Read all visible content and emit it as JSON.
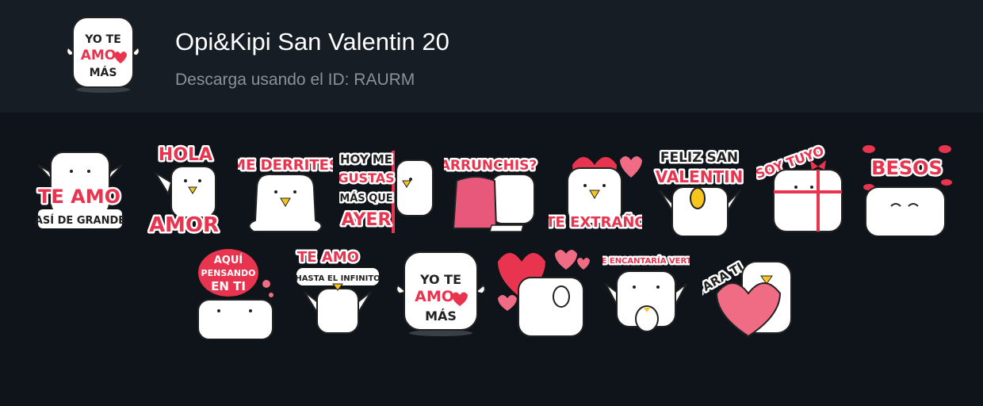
{
  "pack": {
    "title": "Opi&Kipi San Valentin 20",
    "subtitle": "Descarga usando el ID: RAURM",
    "icon": {
      "line1": "YO TE",
      "line2": "AMO",
      "line3": "MÁS"
    }
  },
  "colors": {
    "background": "#0f141b",
    "header": "#161d25",
    "accent_red": "#e8344e",
    "pink": "#f06b84",
    "beak": "#f7c51e"
  },
  "stickers_row1": [
    {
      "name": "te-amo-asi-de-grande",
      "lines": [
        "TE AMO",
        "ASÍ DE GRANDE"
      ]
    },
    {
      "name": "hola-amor",
      "lines": [
        "HOLA",
        "AMOR"
      ]
    },
    {
      "name": "me-derrites",
      "lines": [
        "ME DERRITES"
      ]
    },
    {
      "name": "hoy-me-gustas",
      "lines": [
        "HOY ME",
        "GUSTAS",
        "MÁS QUE",
        "AYER"
      ]
    },
    {
      "name": "arrunchis",
      "lines": [
        "ARRUNCHIS?"
      ]
    },
    {
      "name": "te-extrano",
      "lines": [
        "TE EXTRAÑO"
      ]
    },
    {
      "name": "feliz-san-valentin",
      "lines": [
        "FELIZ SAN",
        "VALENTIN"
      ]
    },
    {
      "name": "soy-tuyo",
      "lines": [
        "SOY TUYO"
      ]
    },
    {
      "name": "besos",
      "lines": [
        "BESOS"
      ]
    }
  ],
  "stickers_row2": [
    {
      "name": "aqui-pensando-en-ti",
      "lines": [
        "AQUÍ",
        "PENSANDO",
        "EN TI"
      ]
    },
    {
      "name": "te-amo-hasta-el-infinito",
      "lines": [
        "TE AMO",
        "HASTA EL INFINITO"
      ]
    },
    {
      "name": "yo-te-amo-mas",
      "lines": [
        "YO TE",
        "AMO",
        "MÁS"
      ]
    },
    {
      "name": "hearts",
      "lines": []
    },
    {
      "name": "me-encantaria-verte",
      "lines": [
        "ME ENCANTARÍA VERTE"
      ]
    },
    {
      "name": "para-ti",
      "lines": [
        "PARA TI"
      ]
    }
  ]
}
